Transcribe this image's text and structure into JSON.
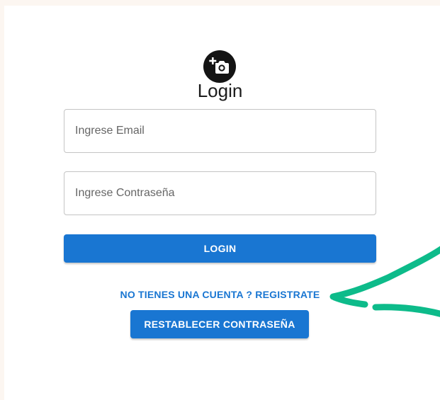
{
  "login": {
    "title": "Login",
    "email_placeholder": "Ingrese Email",
    "password_placeholder": "Ingrese Contraseña",
    "login_label": "LOGIN",
    "register_label": "NO TIENES UNA CUENTA ? REGISTRATE",
    "reset_label": "RESTABLECER CONTRASEÑA"
  },
  "icons": {
    "logo": "add-a-photo-icon",
    "annotation": "arrow-annotation"
  },
  "colors": {
    "primary": "#1976d2",
    "background": "#fcf6f1",
    "arrow": "#0dbb8a"
  }
}
